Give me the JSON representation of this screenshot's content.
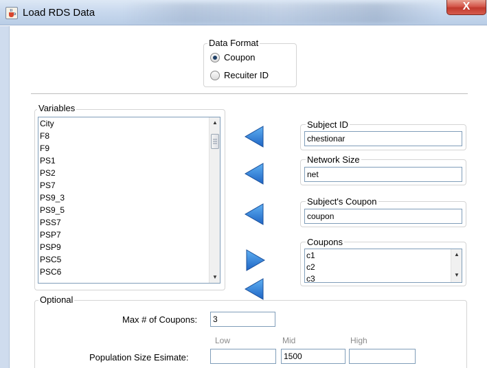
{
  "window": {
    "title": "Load RDS Data",
    "close_glyph": "X"
  },
  "data_format": {
    "legend": "Data Format",
    "options": [
      {
        "label": "Coupon",
        "selected": true
      },
      {
        "label": "Recuiter ID",
        "selected": false
      }
    ]
  },
  "variables": {
    "legend": "Variables",
    "items": [
      "City",
      "F8",
      "F9",
      "PS1",
      "PS2",
      "PS7",
      "PS9_3",
      "PS9_5",
      "PSS7",
      "PSP7",
      "PSP9",
      "PSC5",
      "PSC6"
    ]
  },
  "fields": {
    "subject_id": {
      "label": "Subject ID",
      "value": "chestionar"
    },
    "network_size": {
      "label": "Network Size",
      "value": "net"
    },
    "subjects_coupon": {
      "label": "Subject's Coupon",
      "value": "coupon"
    },
    "coupons": {
      "label": "Coupons",
      "items": [
        "c1",
        "c2",
        "c3"
      ]
    }
  },
  "optional": {
    "legend": "Optional",
    "max_coupons": {
      "label": "Max # of Coupons:",
      "value": "3"
    },
    "population": {
      "label": "Population Size Esimate:",
      "low_hint": "Low",
      "mid_hint": "Mid",
      "high_hint": "High",
      "low_value": "",
      "mid_value": "1500",
      "high_value": ""
    }
  },
  "icons": {
    "app": "java-cup-icon",
    "assign": "arrow-left-icon",
    "remove": "arrow-right-icon"
  },
  "colors": {
    "arrow_blue": "#2f7fd6",
    "close_red": "#c8453a"
  }
}
